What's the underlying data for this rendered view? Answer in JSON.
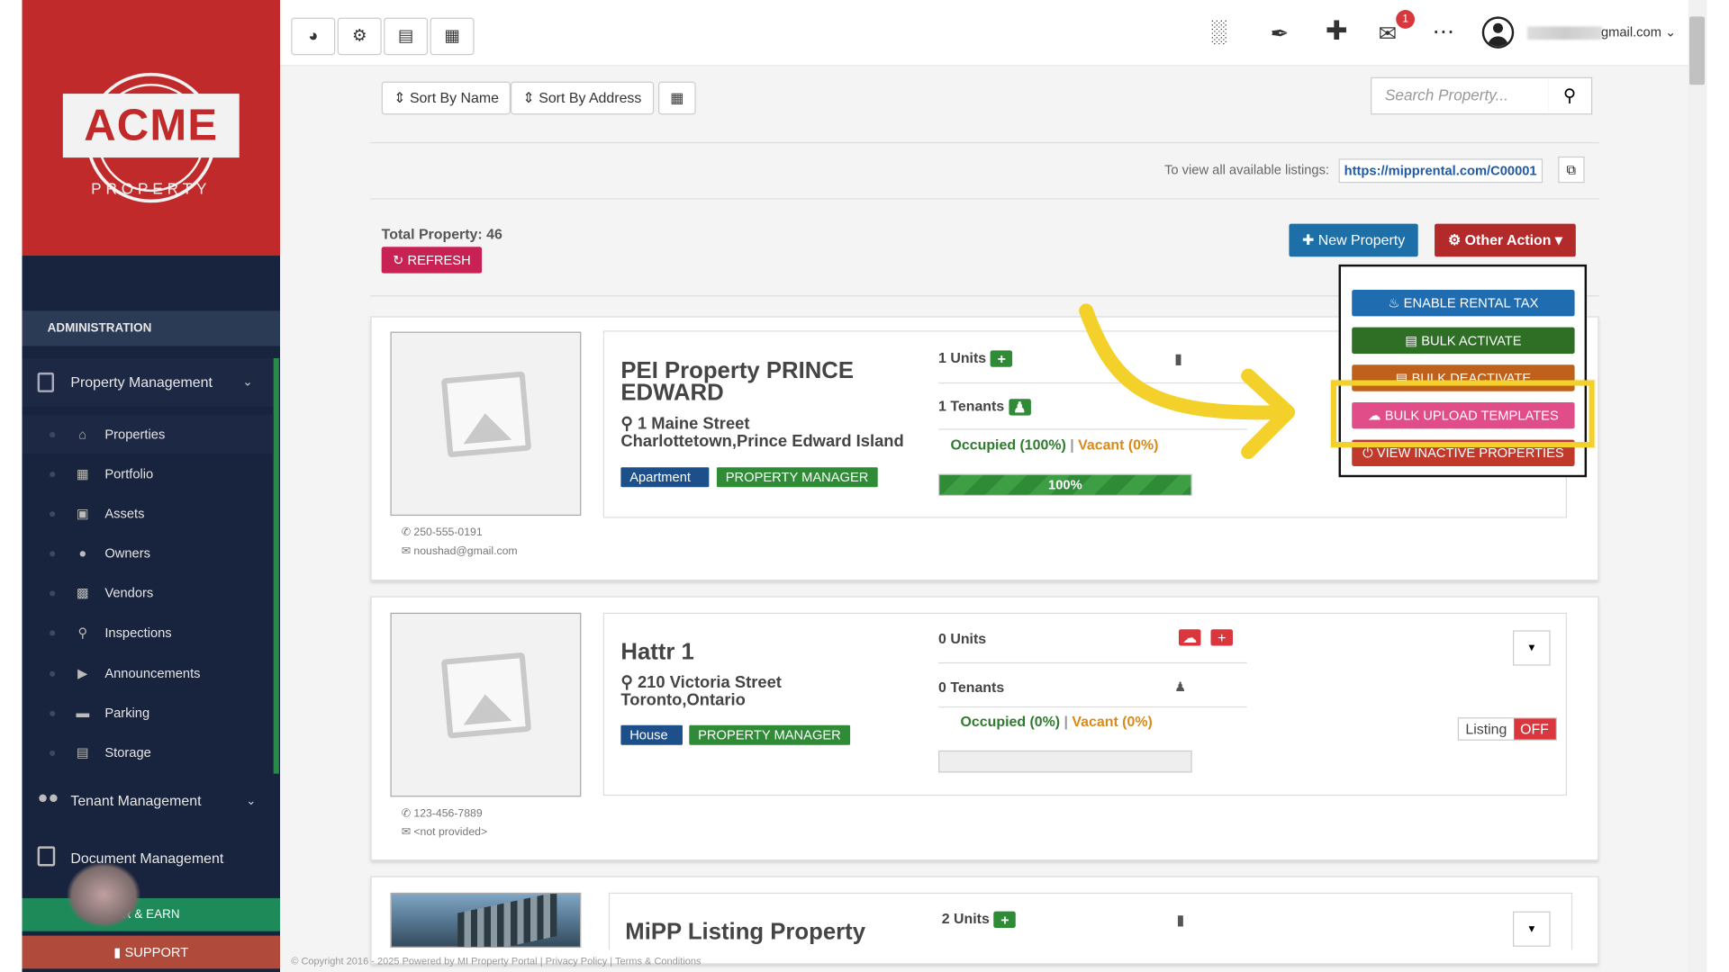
{
  "sidebar": {
    "logo_text": "ACME",
    "logo_subtext": "PROPERTY",
    "section_header": "ADMINISTRATION",
    "property_management": "Property Management",
    "items": [
      {
        "label": "Properties"
      },
      {
        "label": "Portfolio"
      },
      {
        "label": "Assets"
      },
      {
        "label": "Owners"
      },
      {
        "label": "Vendors"
      },
      {
        "label": "Inspections"
      },
      {
        "label": "Announcements"
      },
      {
        "label": "Parking"
      },
      {
        "label": "Storage"
      }
    ],
    "tenant_management": "Tenant Management",
    "document_management": "Document Management",
    "refer_earn": "R & EARN",
    "support": "SUPPORT"
  },
  "topbar": {
    "mail_badge": "1",
    "user_email_suffix": "gmail.com"
  },
  "toolbar": {
    "sort_by_name": "Sort By Name",
    "sort_by_address": "Sort By Address",
    "search_placeholder": "Search Property..."
  },
  "listing": {
    "prefix": "To view all available listings:",
    "url": "https://mipprental.com/C00001"
  },
  "summary": {
    "total_property": "Total Property: 46",
    "refresh": "REFRESH"
  },
  "actions": {
    "new_property": "New Property",
    "other_action": "Other Action"
  },
  "dropdown": {
    "items": [
      {
        "label": "ENABLE RENTAL TAX",
        "color": "#1f6db0"
      },
      {
        "label": "BULK ACTIVATE",
        "color": "#2e6e25"
      },
      {
        "label": "BULK DEACTIVATE",
        "color": "#c0611b"
      },
      {
        "label": "BULK UPLOAD TEMPLATES",
        "color": "#e04d88"
      },
      {
        "label": "VIEW INACTIVE PROPERTIES",
        "color": "#c0392b"
      }
    ]
  },
  "properties": [
    {
      "title": "PEI Property PRINCE EDWARD",
      "address_line1": "1 Maine Street",
      "address_line2": "Charlottetown,Prince Edward Island",
      "type": "Apartment",
      "manager_tag": "PROPERTY MANAGER",
      "phone": "250-555-0191",
      "email": "noushad@gmail.com",
      "units": "1 Units",
      "tenants": "1 Tenants",
      "occupied": "Occupied (100%)",
      "vacant": "Vacant (0%)",
      "occupancy_pct": 100,
      "occupancy_label": "100%"
    },
    {
      "title": "Hattr 1",
      "address_line1": "210 Victoria Street",
      "address_line2": "Toronto,Ontario",
      "type": "House",
      "manager_tag": "PROPERTY MANAGER",
      "phone": "123-456-7889",
      "email": "<not provided>",
      "units": "0 Units",
      "tenants": "0 Tenants",
      "occupied": "Occupied (0%)",
      "vacant": "Vacant (0%)",
      "occupancy_pct": 0,
      "listing_label": "Listing",
      "listing_state": "OFF"
    },
    {
      "title": "MiPP Listing Property",
      "units": "2 Units"
    }
  ],
  "footer": {
    "text": "© Copyright 2016 - 2025 Powered by MI Property Portal | Privacy Policy | Terms & Conditions"
  },
  "colors": {
    "brand_red": "#c12a2a",
    "sidebar_bg": "#18233d",
    "highlight": "#f3d12a",
    "arrow": "#f3d12a"
  }
}
